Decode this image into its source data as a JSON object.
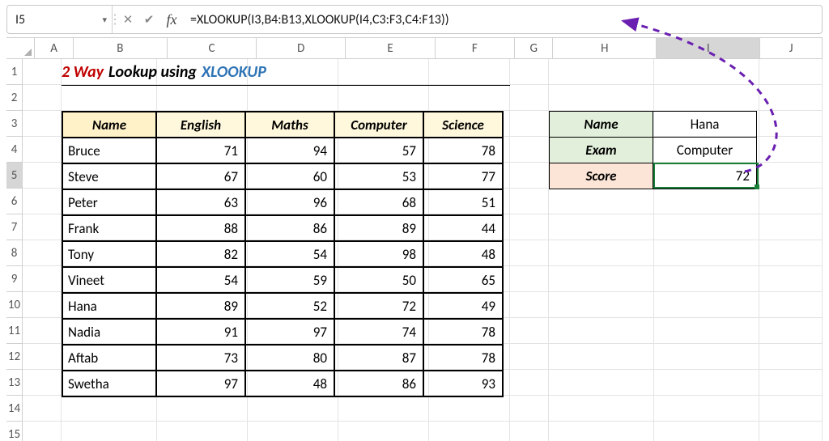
{
  "formula_bar": {
    "name_box": "I5",
    "formula": "=XLOOKUP(I3,B4:B13,XLOOKUP(I4,C3:F3,C4:F13))"
  },
  "columns": [
    "A",
    "B",
    "C",
    "D",
    "E",
    "F",
    "G",
    "H",
    "I",
    "J"
  ],
  "row_count": 15,
  "selected_cell": "I5",
  "title": {
    "a": "2 Way",
    "b": "Lookup using",
    "c": "XLOOKUP"
  },
  "table": {
    "headers": [
      "Name",
      "English",
      "Maths",
      "Computer",
      "Science"
    ],
    "rows": [
      {
        "name": "Bruce",
        "english": 71,
        "maths": 94,
        "computer": 57,
        "science": 78
      },
      {
        "name": "Steve",
        "english": 67,
        "maths": 60,
        "computer": 53,
        "science": 77
      },
      {
        "name": "Peter",
        "english": 63,
        "maths": 96,
        "computer": 68,
        "science": 51
      },
      {
        "name": "Frank",
        "english": 88,
        "maths": 86,
        "computer": 89,
        "science": 44
      },
      {
        "name": "Tony",
        "english": 82,
        "maths": 54,
        "computer": 98,
        "science": 48
      },
      {
        "name": "Vineet",
        "english": 54,
        "maths": 59,
        "computer": 50,
        "science": 65
      },
      {
        "name": "Hana",
        "english": 89,
        "maths": 52,
        "computer": 72,
        "science": 49
      },
      {
        "name": "Nadia",
        "english": 91,
        "maths": 97,
        "computer": 74,
        "science": 78
      },
      {
        "name": "Aftab",
        "english": 73,
        "maths": 80,
        "computer": 87,
        "science": 78
      },
      {
        "name": "Swetha",
        "english": 97,
        "maths": 48,
        "computer": 86,
        "science": 93
      }
    ]
  },
  "lookup": {
    "labels": {
      "name": "Name",
      "exam": "Exam",
      "score": "Score"
    },
    "values": {
      "name": "Hana",
      "exam": "Computer",
      "score": 72
    }
  }
}
